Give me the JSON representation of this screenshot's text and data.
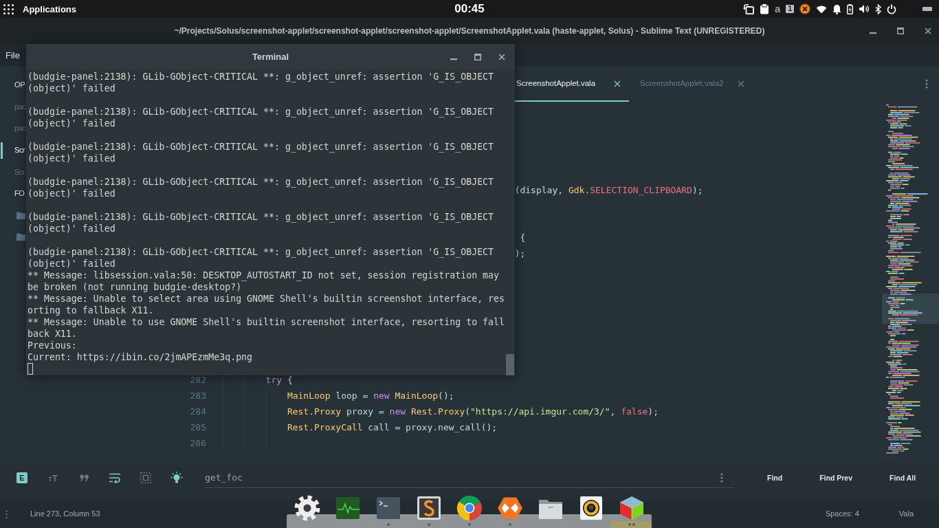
{
  "top_panel": {
    "menu_label": "Applications",
    "clock": "00:45",
    "tray": {
      "layout": "a",
      "workspace": "1"
    }
  },
  "window": {
    "title": "~/Projects/Solus/screenshot-applet/screenshot-applet/screenshot-applet/ScreenshotApplet.vala (haste-applet, Solus) - Sublime Text (UNREGISTERED)",
    "menu": [
      "File"
    ]
  },
  "sidebar": {
    "sections": [
      {
        "title": "OP",
        "items": [
          {
            "kind": "file",
            "label": "pac",
            "selected": false
          },
          {
            "kind": "file",
            "label": "pac",
            "selected": false
          },
          {
            "kind": "file",
            "label": "Scr",
            "selected": true
          },
          {
            "kind": "file",
            "label": "Scr",
            "selected": false
          }
        ]
      },
      {
        "title": "FO",
        "items": [
          {
            "kind": "folder",
            "selected": false
          },
          {
            "kind": "folder",
            "selected": false
          }
        ]
      }
    ]
  },
  "tabs": [
    {
      "label": "ScreenshotApplet.vala",
      "selected": true
    },
    {
      "label": "ScreenshotApplet.vala2",
      "selected": false
    }
  ],
  "editor": {
    "rows": [
      {
        "kind": "covered"
      },
      {
        "kind": "covered"
      },
      {
        "kind": "covered"
      },
      {
        "kind": "covered"
      },
      {
        "kind": "covered"
      },
      {
        "kind": "fragment",
        "tokens": [
          {
            "kind": "plain",
            "text": "(display, "
          },
          {
            "kind": "type",
            "text": "Gdk"
          },
          {
            "kind": "operator",
            "text": "."
          },
          {
            "kind": "constant",
            "text": "SELECTION_CLIPBOARD"
          },
          {
            "kind": "plain",
            "text": ");"
          }
        ]
      },
      {
        "kind": "covered"
      },
      {
        "kind": "covered"
      },
      {
        "kind": "fragment",
        "tokens": [
          {
            "kind": "plain",
            "text": " {"
          }
        ]
      },
      {
        "kind": "fragment",
        "tokens": [
          {
            "kind": "plain",
            "text": ");"
          }
        ]
      },
      {
        "kind": "covered"
      },
      {
        "kind": "covered"
      },
      {
        "kind": "covered"
      },
      {
        "kind": "covered"
      },
      {
        "kind": "covered"
      },
      {
        "kind": "covered"
      },
      {
        "kind": "covered"
      },
      {
        "kind": "block",
        "children": [
          {
            "kind": "block",
            "children": [
              {
                "kind": "line",
                "number": "282",
                "tokens": [
                  {
                    "kind": "keyword",
                    "text": "try"
                  },
                  {
                    "kind": "plain",
                    "text": " {"
                  }
                ],
                "children": [
                  {
                    "kind": "line",
                    "number": "283",
                    "tokens": [
                      {
                        "kind": "type",
                        "text": "MainLoop"
                      },
                      {
                        "kind": "plain",
                        "text": " loop "
                      },
                      {
                        "kind": "operator",
                        "text": "="
                      },
                      {
                        "kind": "keyword",
                        "text": " new"
                      },
                      {
                        "kind": "type",
                        "text": " MainLoop"
                      },
                      {
                        "kind": "plain",
                        "text": "();"
                      }
                    ]
                  },
                  {
                    "kind": "line",
                    "number": "284",
                    "tokens": [
                      {
                        "kind": "type",
                        "text": "Rest.Proxy"
                      },
                      {
                        "kind": "plain",
                        "text": " proxy "
                      },
                      {
                        "kind": "operator",
                        "text": "="
                      },
                      {
                        "kind": "keyword",
                        "text": " new"
                      },
                      {
                        "kind": "type",
                        "text": " Rest.Proxy"
                      },
                      {
                        "kind": "plain",
                        "text": "("
                      },
                      {
                        "kind": "string",
                        "text": "\"https://api.imgur.com/3/\""
                      },
                      {
                        "kind": "plain",
                        "text": ", "
                      },
                      {
                        "kind": "constant",
                        "text": "false"
                      },
                      {
                        "kind": "plain",
                        "text": ");"
                      }
                    ]
                  },
                  {
                    "kind": "line",
                    "number": "285",
                    "tokens": [
                      {
                        "kind": "type",
                        "text": "Rest.ProxyCall"
                      },
                      {
                        "kind": "plain",
                        "text": " call "
                      },
                      {
                        "kind": "operator",
                        "text": "="
                      },
                      {
                        "kind": "plain",
                        "text": " proxy.new_call();"
                      }
                    ]
                  },
                  {
                    "kind": "line",
                    "number": "286"
                  }
                ]
              }
            ]
          }
        ]
      }
    ]
  },
  "terminal": {
    "title": "Terminal",
    "blocks": [
      {
        "lines": [
          "(budgie-panel:2138): GLib-GObject-CRITICAL **: g_object_unref: assertion 'G_IS_OBJECT (object)' failed"
        ]
      },
      {
        "lines": [
          "(budgie-panel:2138): GLib-GObject-CRITICAL **: g_object_unref: assertion 'G_IS_OBJECT (object)' failed"
        ]
      },
      {
        "lines": [
          "(budgie-panel:2138): GLib-GObject-CRITICAL **: g_object_unref: assertion 'G_IS_OBJECT (object)' failed"
        ]
      },
      {
        "lines": [
          "(budgie-panel:2138): GLib-GObject-CRITICAL **: g_object_unref: assertion 'G_IS_OBJECT (object)' failed"
        ]
      },
      {
        "lines": [
          "(budgie-panel:2138): GLib-GObject-CRITICAL **: g_object_unref: assertion 'G_IS_OBJECT (object)' failed"
        ]
      },
      {
        "lines": [
          "(budgie-panel:2138): GLib-GObject-CRITICAL **: g_object_unref: assertion 'G_IS_OBJECT (object)' failed",
          "** Message: libsession.vala:50: DESKTOP_AUTOSTART_ID not set, session registration may be broken (not running budgie-desktop?)",
          "** Message: Unable to select area using GNOME Shell's builtin screenshot interface, resorting to fallback X11.",
          "** Message: Unable to use GNOME Shell's builtin screenshot interface, resorting to fallback X11.",
          "Previous:",
          "Current: https://ibin.co/2jmAPEzmMe3q.png"
        ]
      }
    ]
  },
  "find_panel": {
    "toggles": [
      {
        "kind": "letter",
        "text": "E",
        "on": true
      },
      {
        "kind": "case",
        "text": "TT",
        "on": false
      },
      {
        "kind": "quotes",
        "on": false
      },
      {
        "kind": "wrap",
        "on": true
      },
      {
        "kind": "selection",
        "on": false
      },
      {
        "kind": "bulb",
        "on": true
      }
    ],
    "query": "get_foc",
    "buttons": [
      "Find",
      "Find Prev",
      "Find All"
    ]
  },
  "status_bar": {
    "position": "Line 273, Column 53",
    "indentation": "Spaces: 4",
    "syntax": "Vala"
  },
  "dock": {
    "items": [
      {
        "kind": "gear",
        "running": false,
        "extra_window": false,
        "active": false
      },
      {
        "kind": "monitor",
        "running": false,
        "extra_window": false,
        "active": false
      },
      {
        "kind": "console",
        "running": true,
        "extra_window": false,
        "active": false
      },
      {
        "kind": "scurve",
        "running": true,
        "extra_window": false,
        "active": false
      },
      {
        "kind": "ring",
        "running": true,
        "extra_window": false,
        "active": false
      },
      {
        "kind": "hexagon",
        "running": true,
        "extra_window": false,
        "active": false
      },
      {
        "kind": "folder",
        "running": false,
        "extra_window": false,
        "active": false
      },
      {
        "kind": "speaker",
        "running": false,
        "extra_window": false,
        "active": false
      },
      {
        "kind": "cube",
        "running": true,
        "extra_window": true,
        "active": true
      }
    ]
  }
}
